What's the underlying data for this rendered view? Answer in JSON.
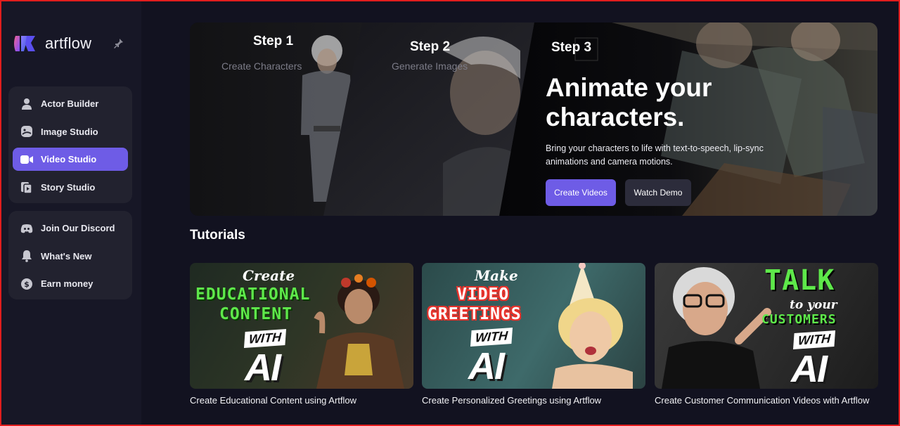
{
  "app": {
    "name": "artflow"
  },
  "sidebar": {
    "primary": [
      {
        "label": "Actor Builder",
        "icon": "person-icon"
      },
      {
        "label": "Image Studio",
        "icon": "image-face-icon"
      },
      {
        "label": "Video Studio",
        "icon": "video-camera-icon",
        "active": true
      },
      {
        "label": "Story Studio",
        "icon": "story-pages-icon"
      }
    ],
    "secondary": [
      {
        "label": "Join Our Discord",
        "icon": "discord-icon"
      },
      {
        "label": "What's New",
        "icon": "bell-icon"
      },
      {
        "label": "Earn money",
        "icon": "dollar-icon"
      }
    ]
  },
  "hero": {
    "steps": [
      {
        "label": "Step 1",
        "sub": "Create Characters"
      },
      {
        "label": "Step 2",
        "sub": "Generate Images"
      },
      {
        "label": "Step 3"
      }
    ],
    "title": "Animate your characters.",
    "description": "Bring your characters to life with text-to-speech, lip-sync animations and camera motions.",
    "primary_button": "Create Videos",
    "secondary_button": "Watch Demo"
  },
  "tutorials": {
    "title": "Tutorials",
    "cards": [
      {
        "caption": "Create Educational Content using Artflow",
        "thumb": {
          "script": "Create",
          "line1": "EDUCATIONAL",
          "line2": "CONTENT",
          "with": "WITH",
          "ai": "AI"
        }
      },
      {
        "caption": "Create Personalized Greetings using Artflow",
        "thumb": {
          "script": "Make",
          "line1": "VIDEO",
          "line2": "GREETINGS",
          "with": "WITH",
          "ai": "AI"
        }
      },
      {
        "caption": "Create Customer Communication Videos with Artflow",
        "thumb": {
          "line1": "TALK",
          "script": "to your",
          "line2": "CUSTOMERS",
          "with": "WITH",
          "ai": "AI"
        }
      }
    ]
  },
  "colors": {
    "accent": "#6e5ce6",
    "background": "#121220",
    "sidebar": "#171726",
    "tutorial_green": "#5ee84a",
    "tutorial_red": "#e8322b"
  }
}
